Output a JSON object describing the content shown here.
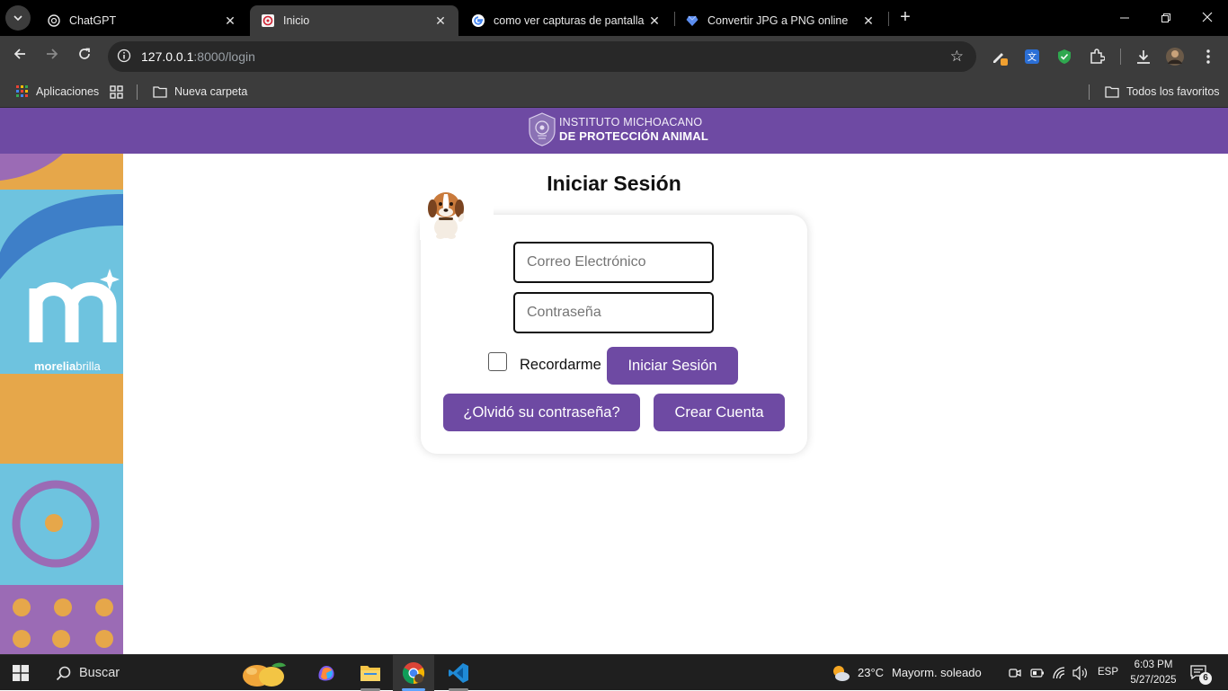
{
  "browser": {
    "tabs": [
      {
        "title": "ChatGPT",
        "icon": "chatgpt-icon",
        "active": false
      },
      {
        "title": "Inicio",
        "icon": "site-icon",
        "active": true
      },
      {
        "title": "como ver capturas de pantalla e",
        "icon": "google-icon",
        "active": false
      },
      {
        "title": "Convertir JPG a PNG online",
        "icon": "heart-diamond-icon",
        "active": false
      }
    ],
    "url": {
      "host": "127.0.0.1",
      "path": ":8000/login"
    },
    "bookmarks": {
      "apps": "Aplicaciones",
      "folder": "Nueva carpeta",
      "all": "Todos los favoritos"
    }
  },
  "header": {
    "line1": "INSTITUTO MICHOACANO",
    "line2": "DE PROTECCIÓN ANIMAL",
    "color": "#6e4aa3"
  },
  "side_art": {
    "brand": "morelia",
    "brand_light": "brilla"
  },
  "login": {
    "title": "Iniciar Sesión",
    "email_placeholder": "Correo Electrónico",
    "password_placeholder": "Contraseña",
    "remember_label": "Recordarme",
    "submit_label": "Iniciar Sesión",
    "forgot_label": "¿Olvidó su contraseña?",
    "create_label": "Crear Cuenta",
    "button_color": "#6e4aa3"
  },
  "taskbar": {
    "search_label": "Buscar",
    "weather": {
      "temp": "23°C",
      "desc": "Mayorm. soleado"
    },
    "lang": "ESP",
    "time": "6:03 PM",
    "date": "5/27/2025",
    "notifications": "6"
  }
}
